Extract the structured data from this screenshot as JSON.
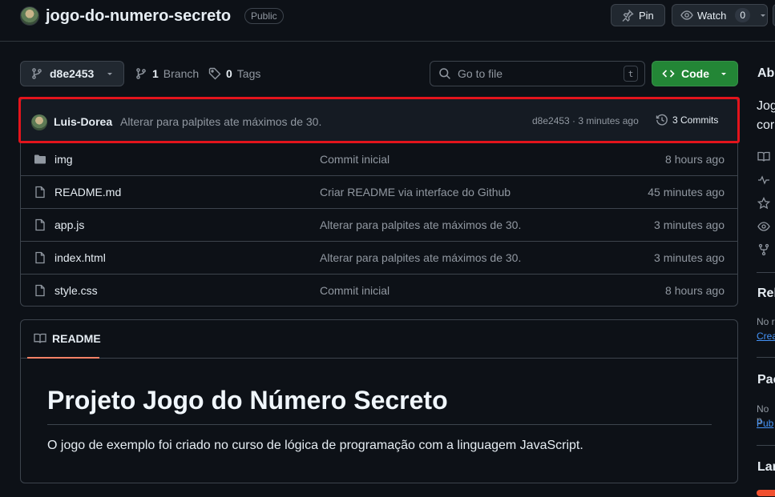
{
  "header": {
    "repo_name": "jogo-do-numero-secreto",
    "visibility": "Public",
    "pin_label": "Pin",
    "watch_label": "Watch",
    "watch_count": "0"
  },
  "toolbar": {
    "branch_ref": "d8e2453",
    "branch_count": "1",
    "branch_label": "Branch",
    "tag_count": "0",
    "tag_label": "Tags",
    "goto_placeholder": "Go to file",
    "goto_shortcut": "t",
    "code_label": "Code"
  },
  "latest_commit": {
    "author": "Luis-Dorea",
    "message": "Alterar para palpites ate máximos de 30.",
    "meta": "d8e2453 · 3 minutes ago",
    "commits_label": "3 Commits"
  },
  "files": [
    {
      "type": "folder",
      "name": "img",
      "message": "Commit inicial",
      "time": "8 hours ago"
    },
    {
      "type": "file",
      "name": "README.md",
      "message": "Criar README via interface do Github",
      "time": "45 minutes ago"
    },
    {
      "type": "file",
      "name": "app.js",
      "message": "Alterar para palpites ate máximos de 30.",
      "time": "3 minutes ago"
    },
    {
      "type": "file",
      "name": "index.html",
      "message": "Alterar para palpites ate máximos de 30.",
      "time": "3 minutes ago"
    },
    {
      "type": "file",
      "name": "style.css",
      "message": "Commit inicial",
      "time": "8 hours ago"
    }
  ],
  "readme": {
    "tab_label": "README",
    "heading": "Projeto Jogo do Número Secreto",
    "paragraph": "O jogo de exemplo foi criado no curso de lógica de programação com a linguagem JavaScript."
  },
  "sidebar": {
    "about_heading": "Abo",
    "about_line1": "Jog",
    "about_line2": "cor",
    "releases_heading": "Rel",
    "releases_text": "No r",
    "releases_link": "Crea",
    "packages_heading": "Pac",
    "packages_text": "No p",
    "packages_link": "Pub",
    "languages_heading": "Lar"
  },
  "colors": {
    "accent_green": "#238636",
    "highlight_red": "#e3141c",
    "link_blue": "#4493f8",
    "tab_underline": "#f78166"
  }
}
